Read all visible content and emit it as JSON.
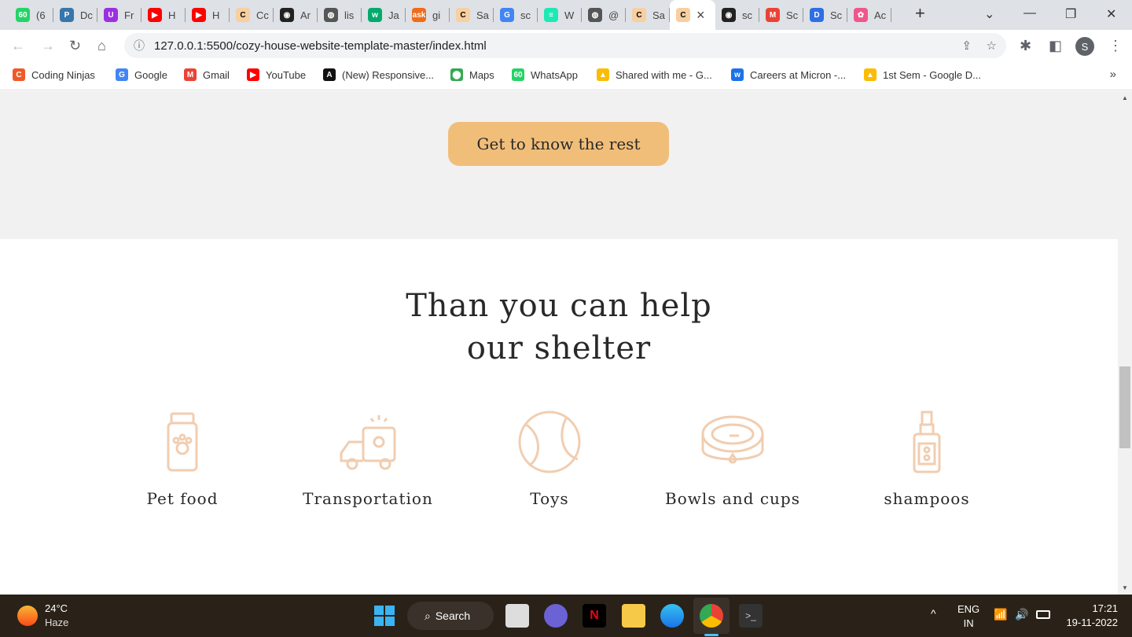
{
  "browser": {
    "tabs": [
      {
        "label": "(6",
        "icon": "whatsapp-60-icon",
        "color": "#25d366",
        "glyph": "60"
      },
      {
        "label": "Dc",
        "icon": "python-icon",
        "color": "#3776ab",
        "glyph": "P"
      },
      {
        "label": "Fr",
        "icon": "u-icon",
        "color": "#9b30e0",
        "glyph": "U"
      },
      {
        "label": "H",
        "icon": "youtube-icon",
        "color": "#ff0000",
        "glyph": "▶"
      },
      {
        "label": "H",
        "icon": "youtube-icon",
        "color": "#ff0000",
        "glyph": "▶"
      },
      {
        "label": "Cc",
        "icon": "c-icon",
        "color": "#f7cfa0",
        "glyph": "C"
      },
      {
        "label": "Ar",
        "icon": "github-icon",
        "color": "#222222",
        "glyph": "◉"
      },
      {
        "label": "lis",
        "icon": "globe-icon",
        "color": "#555555",
        "glyph": "◍"
      },
      {
        "label": "Ja",
        "icon": "w3-icon",
        "color": "#04aa6d",
        "glyph": "w"
      },
      {
        "label": "gi",
        "icon": "ask-icon",
        "color": "#ef6c1a",
        "glyph": "ask"
      },
      {
        "label": "Sa",
        "icon": "c-icon",
        "color": "#f7cfa0",
        "glyph": "C"
      },
      {
        "label": "sc",
        "icon": "google-icon",
        "color": "#4285f4",
        "glyph": "G"
      },
      {
        "label": "W",
        "icon": "list-icon",
        "color": "#1de9b6",
        "glyph": "≡"
      },
      {
        "label": "@",
        "icon": "globe-icon",
        "color": "#555555",
        "glyph": "◍"
      },
      {
        "label": "Sa",
        "icon": "c-icon",
        "color": "#f7cfa0",
        "glyph": "C"
      },
      {
        "label": "",
        "icon": "c-icon",
        "color": "#f7cfa0",
        "glyph": "C",
        "active": true
      },
      {
        "label": "sc",
        "icon": "github-icon",
        "color": "#222222",
        "glyph": "◉"
      },
      {
        "label": "Sc",
        "icon": "gmail-icon",
        "color": "#ea4335",
        "glyph": "M"
      },
      {
        "label": "Sc",
        "icon": "docs-icon",
        "color": "#2f6fe4",
        "glyph": "D"
      },
      {
        "label": "Ac",
        "icon": "app-icon",
        "color": "#f0568a",
        "glyph": "✿"
      }
    ],
    "new_tab": "+",
    "close_tab": "×",
    "url": "127.0.0.1:5500/cozy-house-website-template-master/index.html",
    "profile_initial": "S",
    "bookmarks": [
      {
        "label": "Coding Ninjas",
        "color": "#f05a28",
        "glyph": "C"
      },
      {
        "label": "Google",
        "color": "#4285f4",
        "glyph": "G"
      },
      {
        "label": "Gmail",
        "color": "#ea4335",
        "glyph": "M"
      },
      {
        "label": "YouTube",
        "color": "#ff0000",
        "glyph": "▶"
      },
      {
        "label": "(New) Responsive...",
        "color": "#111111",
        "glyph": "A"
      },
      {
        "label": "Maps",
        "color": "#34a853",
        "glyph": "⬤"
      },
      {
        "label": "WhatsApp",
        "color": "#25d366",
        "glyph": "60"
      },
      {
        "label": "Shared with me - G...",
        "color": "#fbbc04",
        "glyph": "▲"
      },
      {
        "label": "Careers at Micron -...",
        "color": "#1a73e8",
        "glyph": "w"
      },
      {
        "label": "1st Sem - Google D...",
        "color": "#fbbc04",
        "glyph": "▲"
      }
    ],
    "more_bookmarks": "»"
  },
  "page": {
    "cta_label": "Get to know the rest",
    "heading_line1": "Than you can help",
    "heading_line2": "our shelter",
    "accent": "#f1be7a",
    "items": [
      {
        "label": "Pet food",
        "icon": "pet-food-bag-icon"
      },
      {
        "label": "Transportation",
        "icon": "pet-van-icon"
      },
      {
        "label": "Toys",
        "icon": "ball-icon"
      },
      {
        "label": "Bowls and cups",
        "icon": "bowl-icon"
      },
      {
        "label": "shampoos",
        "icon": "shampoo-bottle-icon"
      }
    ]
  },
  "taskbar": {
    "temperature": "24°C",
    "weather": "Haze",
    "search_label": "Search",
    "lang": "ENG",
    "region": "IN",
    "time": "17:21",
    "date": "19-11-2022"
  }
}
